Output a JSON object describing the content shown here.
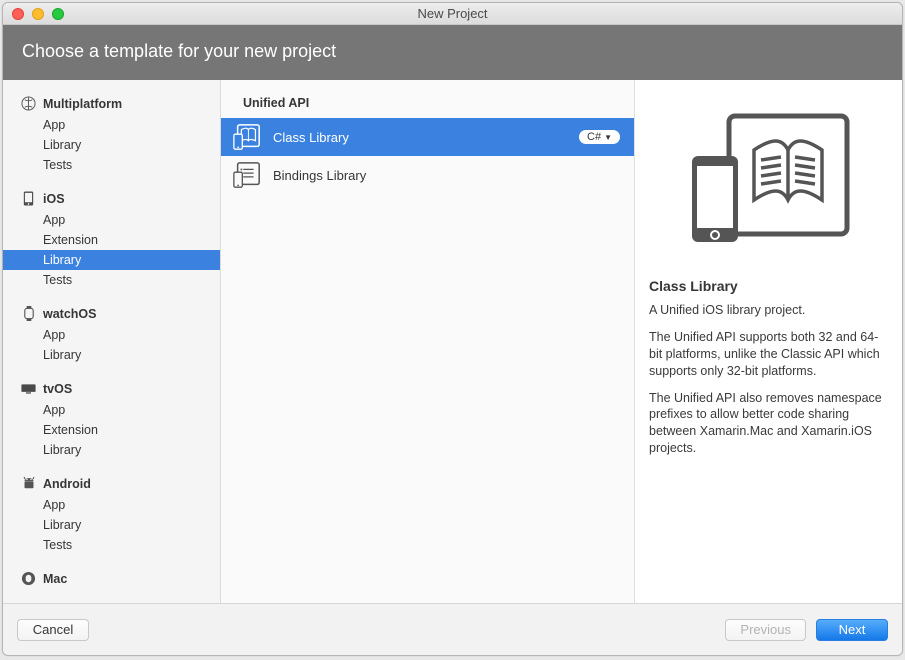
{
  "window": {
    "title": "New Project"
  },
  "banner": {
    "heading": "Choose a template for your new project"
  },
  "sidebar": {
    "categories": [
      {
        "icon": "multiplatform-icon",
        "label": "Multiplatform",
        "items": [
          "App",
          "Library",
          "Tests"
        ]
      },
      {
        "icon": "ios-icon",
        "label": "iOS",
        "items": [
          "App",
          "Extension",
          "Library",
          "Tests"
        ],
        "selected_index": 2
      },
      {
        "icon": "watchos-icon",
        "label": "watchOS",
        "items": [
          "App",
          "Library"
        ]
      },
      {
        "icon": "tvos-icon",
        "label": "tvOS",
        "items": [
          "App",
          "Extension",
          "Library"
        ]
      },
      {
        "icon": "android-icon",
        "label": "Android",
        "items": [
          "App",
          "Library",
          "Tests"
        ]
      },
      {
        "icon": "mac-icon",
        "label": "Mac",
        "items": []
      }
    ]
  },
  "templates": {
    "section_title": "Unified API",
    "items": [
      {
        "icon": "class-library-icon",
        "label": "Class Library",
        "lang": "C#",
        "selected": true
      },
      {
        "icon": "bindings-library-icon",
        "label": "Bindings Library",
        "lang": "",
        "selected": false
      }
    ]
  },
  "detail": {
    "title": "Class Library",
    "p1": "A Unified iOS library project.",
    "p2": "The Unified API supports both 32 and 64-bit platforms, unlike the Classic API which supports only 32-bit platforms.",
    "p3": "The Unified API also removes namespace prefixes to allow better code sharing between Xamarin.Mac and Xamarin.iOS projects."
  },
  "footer": {
    "cancel": "Cancel",
    "previous": "Previous",
    "next": "Next"
  }
}
